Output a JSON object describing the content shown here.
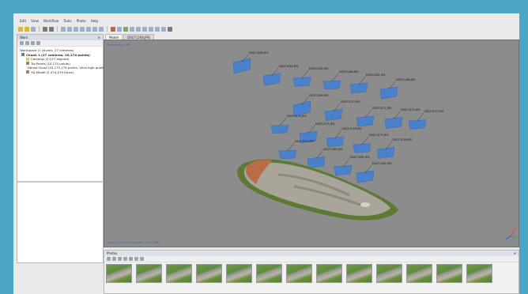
{
  "app": {
    "menus": [
      "Edit",
      "View",
      "Workflow",
      "Tools",
      "Photo",
      "Help"
    ]
  },
  "workspace": {
    "title": "Work",
    "root": "Workspace (1 chunks, 27 cameras)",
    "chunk": "Chunk 1 (27 cameras, 10,174 points)",
    "items": [
      {
        "icon": "cameras",
        "label": "Cameras (27/27 aligned)"
      },
      {
        "icon": "tie-points",
        "label": "Tie Points (10,174 points)"
      },
      {
        "icon": "dense-cloud",
        "label": "Dense Cloud (10,175,179 points, Ultra high quality)"
      },
      {
        "icon": "3d-model",
        "label": "3D Model (2,474,579 faces)"
      }
    ]
  },
  "tabs": [
    {
      "label": "Model",
      "active": true
    },
    {
      "label": "DSCF1266.JPG",
      "active": false
    }
  ],
  "viewport": {
    "perspective_label": "Perspective 30°",
    "status": "Faces: 2,474,579  Vertices: 1,262,586",
    "cameras": [
      {
        "label": "DSCF1263.JPG"
      },
      {
        "label": "DSCF1264.JPG"
      },
      {
        "label": "DSCF1265.JPG"
      },
      {
        "label": "DSCF1266.JPG"
      },
      {
        "label": "DSCF1267.JPG"
      },
      {
        "label": "DSCF1268.JPG"
      },
      {
        "label": "DSCF1269.JPG"
      },
      {
        "label": "DSCF1270.JPG"
      },
      {
        "label": "DSCF1271.JPG"
      },
      {
        "label": "DSCF1272.JPG"
      },
      {
        "label": "DSCF1273.JPG"
      },
      {
        "label": "DSCF1274.JPG"
      },
      {
        "label": "DSCF1275.JPG"
      },
      {
        "label": "DSCF1276.JPG"
      },
      {
        "label": "DSCF1277.JPG"
      },
      {
        "label": "DSCF1278.JPG"
      },
      {
        "label": "DSCF1279.JPG"
      },
      {
        "label": "DSCF1280.JPG"
      },
      {
        "label": "DSCF1281.JPG"
      },
      {
        "label": "DSCF1282.JPG"
      }
    ]
  },
  "photos": {
    "title": "Photos",
    "thumbnail_count": 13
  },
  "colors": {
    "camera_plane": "#3d7fd6",
    "viewport_bg": "#8c8c8c",
    "desktop": "#4aa6c2"
  }
}
